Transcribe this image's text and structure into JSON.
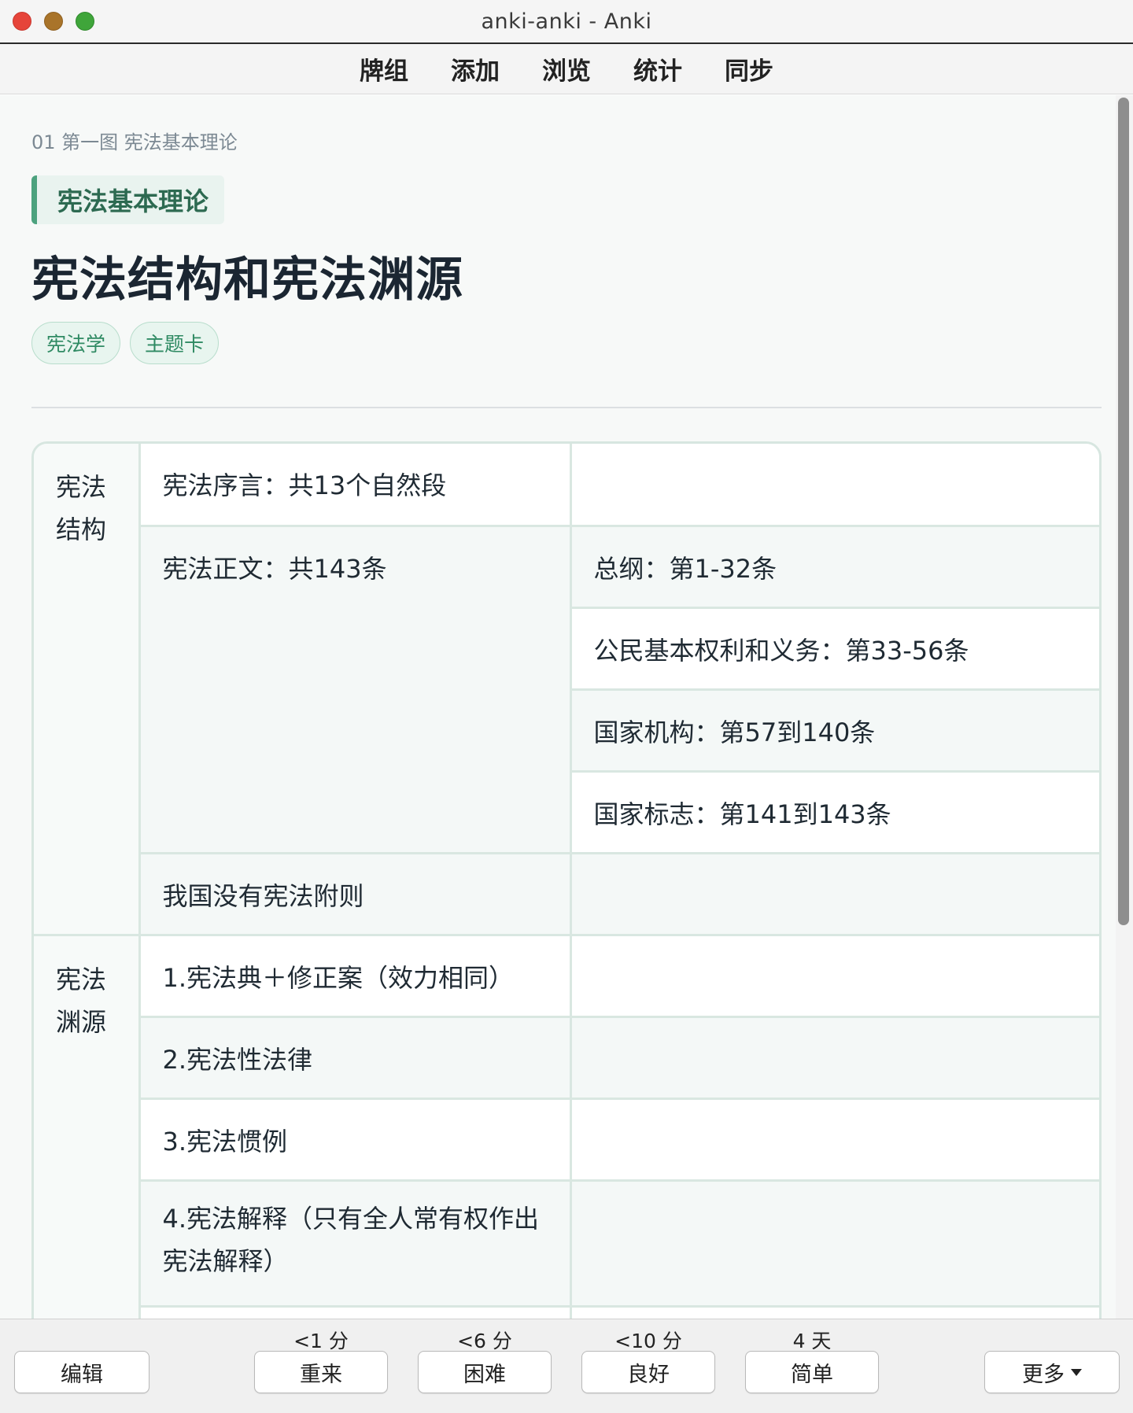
{
  "window": {
    "title": "anki-anki - Anki"
  },
  "toolbar": {
    "items": [
      "牌组",
      "添加",
      "浏览",
      "统计",
      "同步"
    ]
  },
  "card": {
    "breadcrumb": "01 第一图 宪法基本理论",
    "section": "宪法基本理论",
    "title": "宪法结构和宪法渊源",
    "tags": [
      "宪法学",
      "主题卡"
    ],
    "groups": {
      "structure": "宪法\n结构",
      "sources": "宪法\n渊源"
    },
    "rows": {
      "preamble": "宪法序言：共13个自然段",
      "body": "宪法正文：共143条",
      "general": "总纲：第1-32条",
      "rights": "公民基本权利和义务：第33-56条",
      "organs": "国家机构：第57到140条",
      "symbols": "国家标志：第141到143条",
      "no_appendix": "我国没有宪法附则",
      "src1": "1.宪法典＋修正案（效力相同）",
      "src2": "2.宪法性法律",
      "src3": "3.宪法惯例",
      "src4": "4.宪法解释（只有全人常有权作出宪法解释）"
    }
  },
  "bottombar": {
    "edit": "编辑",
    "more": "更多",
    "answers": [
      {
        "interval": "<1 分",
        "label": "重来"
      },
      {
        "interval": "<6 分",
        "label": "困难"
      },
      {
        "interval": "<10 分",
        "label": "良好"
      },
      {
        "interval": "4 天",
        "label": "简单"
      }
    ]
  },
  "colors": {
    "accent_green": "#4ca27e",
    "tag_text": "#2f8a63",
    "red": "#e6443a",
    "yellow": "#a9742a",
    "green": "#3fa53a"
  }
}
